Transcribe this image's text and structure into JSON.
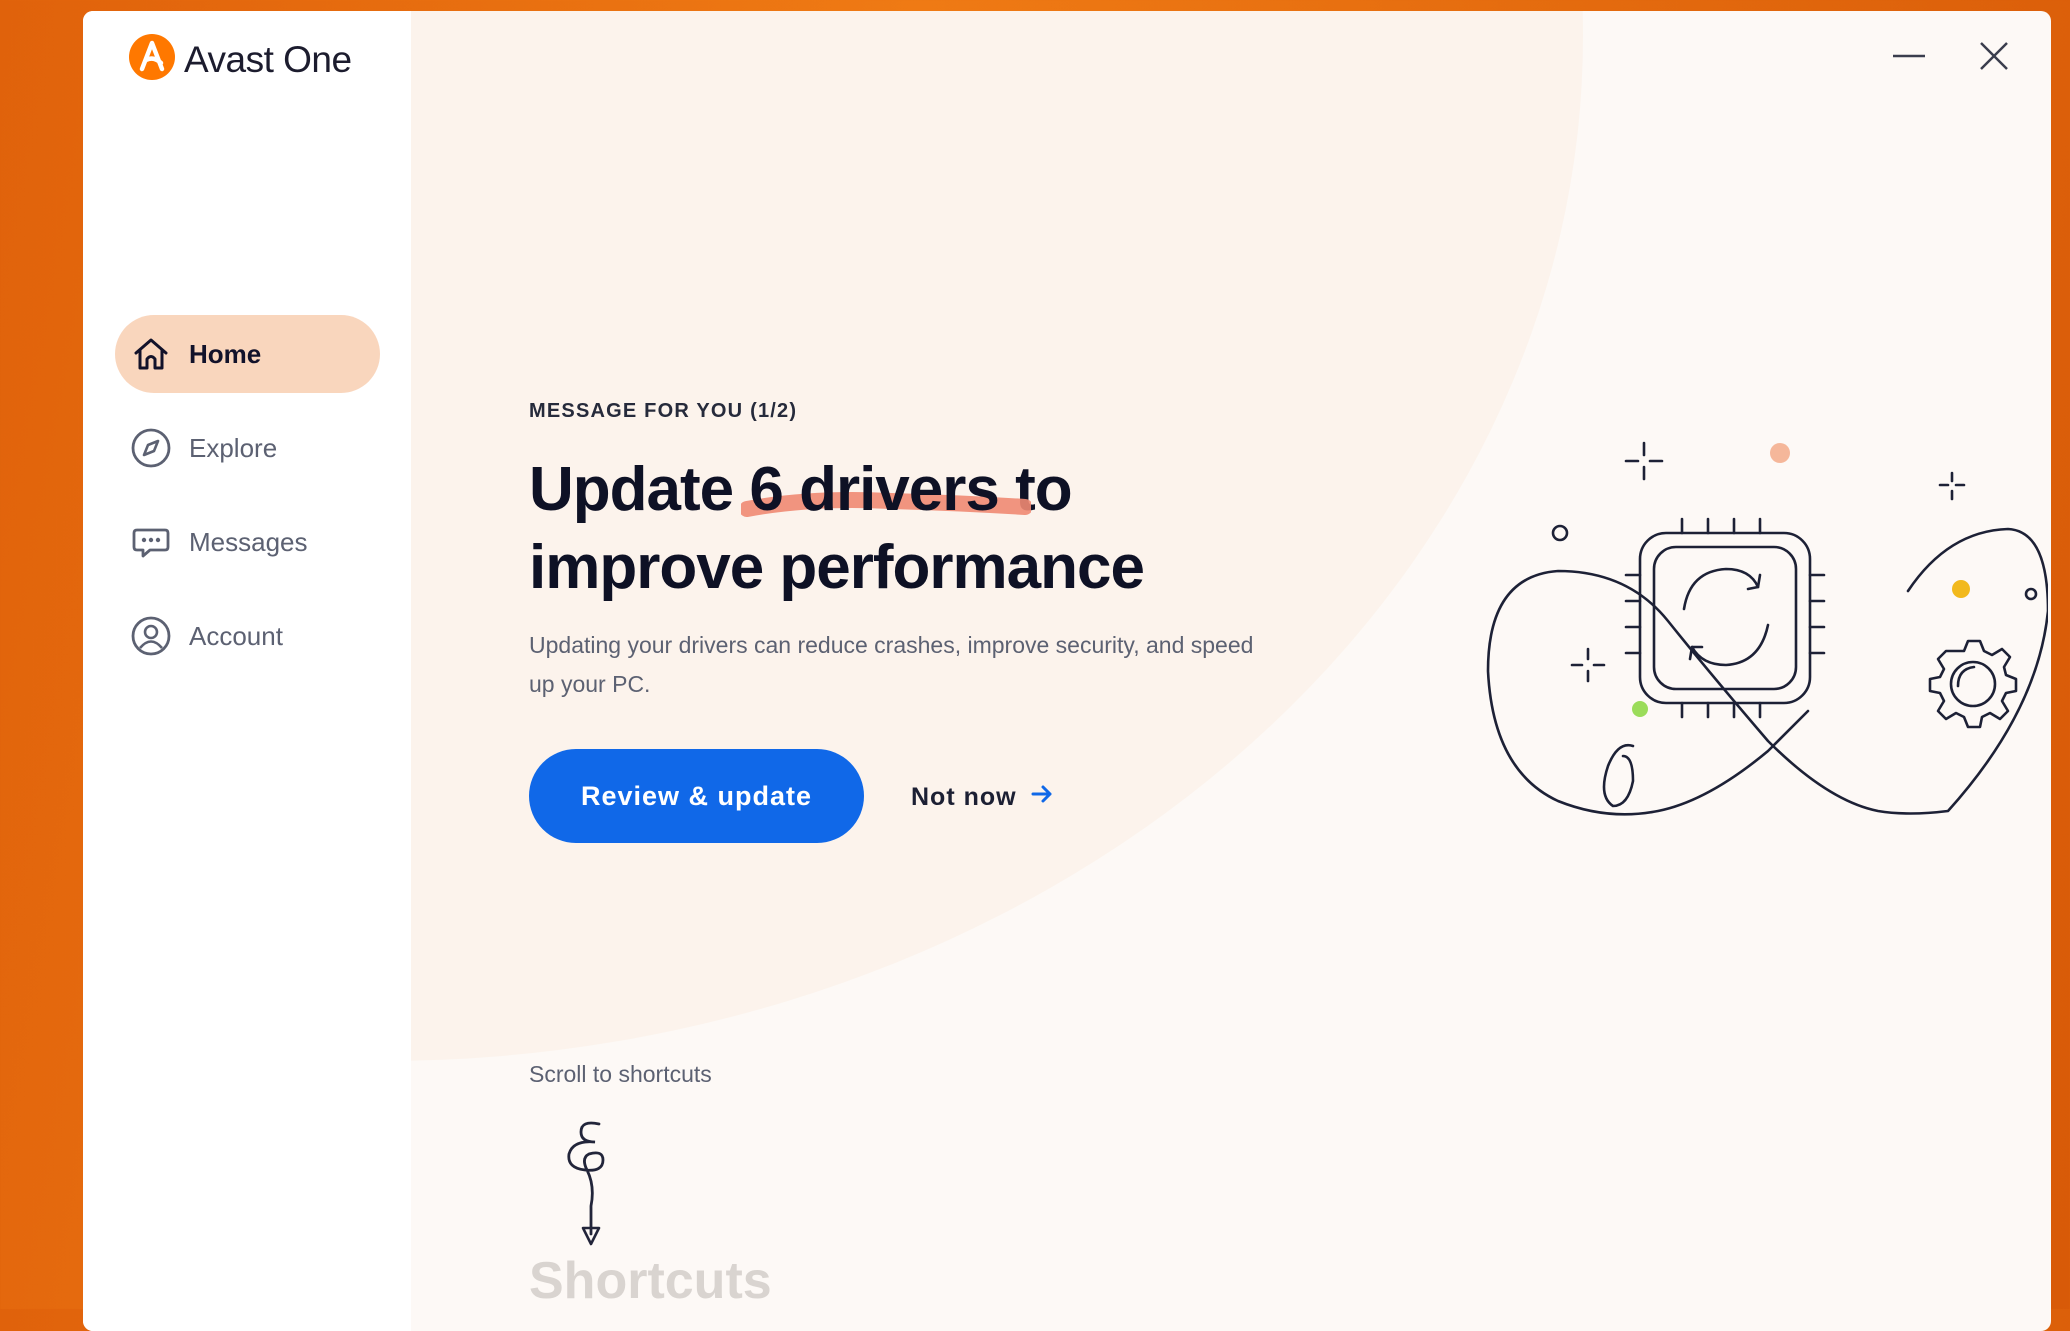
{
  "app": {
    "name": "Avast One"
  },
  "window_controls": {
    "minimize_icon": "minimize-icon",
    "close_icon": "close-icon"
  },
  "sidebar": {
    "items": [
      {
        "label": "Home",
        "icon": "home-icon",
        "active": true
      },
      {
        "label": "Explore",
        "icon": "compass-icon",
        "active": false
      },
      {
        "label": "Messages",
        "icon": "chat-bubble-icon",
        "active": false
      },
      {
        "label": "Account",
        "icon": "user-circle-icon",
        "active": false
      }
    ]
  },
  "message": {
    "eyebrow": "MESSAGE FOR YOU (1/2)",
    "headline_prefix": "Update ",
    "headline_highlight": "6 drivers",
    "headline_suffix": " to improve performance",
    "description": "Updating your drivers can reduce crashes, improve security, and speed up your PC.",
    "primary_button": "Review & update",
    "secondary_button": "Not now"
  },
  "scroll": {
    "hint": "Scroll to shortcuts",
    "next_section": "Shortcuts"
  },
  "colors": {
    "accent": "#ff7800",
    "primary_button": "#1068e8",
    "nav_active": "#f9d6bd",
    "highlight": "#f08a73"
  }
}
